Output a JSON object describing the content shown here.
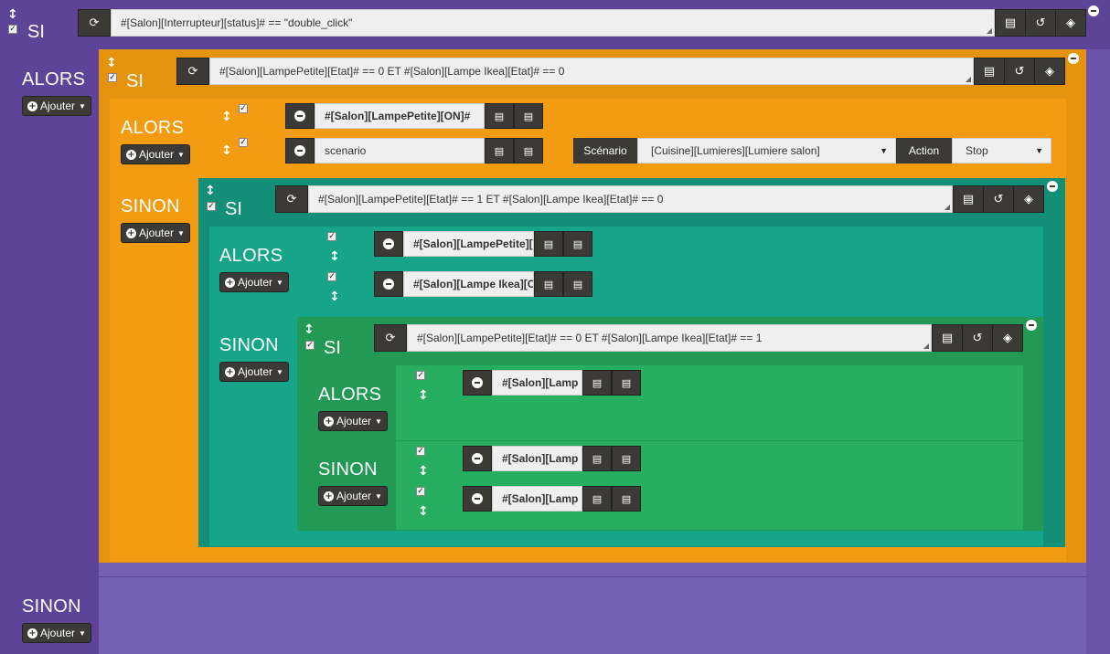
{
  "labels": {
    "si": "SI",
    "alors": "ALORS",
    "sinon": "SINON",
    "ajouter": "Ajouter"
  },
  "root": {
    "condition": "#[Salon][Interrupteur][status]# == \"double_click\""
  },
  "level1": {
    "condition": "#[Salon][LampePetite][Etat]# == 0 ET #[Salon][Lampe Ikea][Etat]# == 0",
    "actions": [
      {
        "value": "#[Salon][LampePetite][ON]#"
      },
      {
        "value": "scenario",
        "scenario_label": "Scénario",
        "scenario_value": "[Cuisine][Lumieres][Lumiere salon]",
        "action_label": "Action",
        "action_value": "Stop"
      }
    ]
  },
  "level2": {
    "condition": "#[Salon][LampePetite][Etat]# == 1 ET #[Salon][Lampe Ikea][Etat]# == 0",
    "actions": [
      {
        "value": "#[Salon][LampePetite]["
      },
      {
        "value": "#[Salon][Lampe Ikea][O"
      }
    ]
  },
  "level3": {
    "condition": "#[Salon][LampePetite][Etat]# == 0 ET #[Salon][Lampe Ikea][Etat]# == 1",
    "alors_actions": [
      {
        "value": "#[Salon][Lamp"
      }
    ],
    "sinon_actions": [
      {
        "value": "#[Salon][Lamp"
      },
      {
        "value": "#[Salon][Lamp"
      }
    ]
  },
  "icons": {
    "refresh": "refresh-icon",
    "expression": "list-icon",
    "history": "history-icon",
    "cube": "cube-icon",
    "minus": "minus-icon",
    "move": "arrows-v-icon",
    "check": "checkbox-icon"
  },
  "colors": {
    "purple": "#5d4499",
    "orange": "#e5930f",
    "teal_dark": "#148f77",
    "teal": "#17a589",
    "green": "#27ae60",
    "dark_button": "#3b3a36"
  }
}
